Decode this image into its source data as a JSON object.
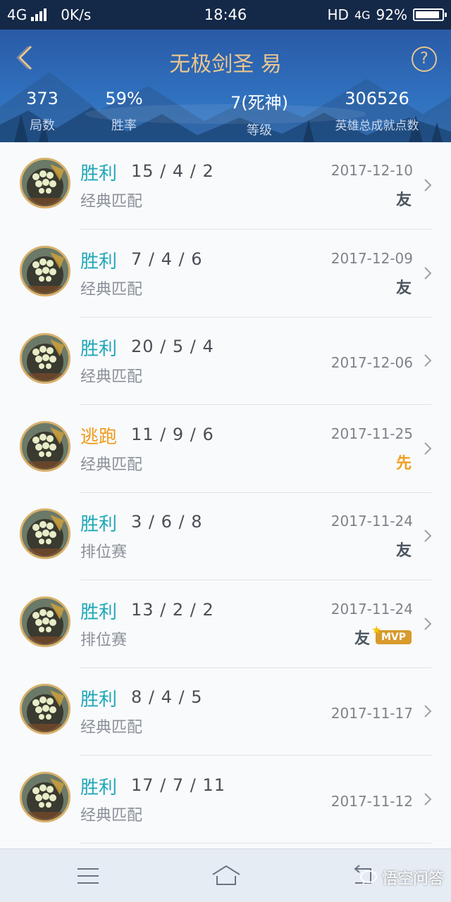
{
  "status_bar": {
    "network": "4G",
    "speed": "0K/s",
    "time": "18:46",
    "hd": "HD",
    "network_right": "4G",
    "battery": "92%",
    "battery_level": 0.92
  },
  "header": {
    "title": "无极剑圣 易",
    "stats": [
      {
        "value": "373",
        "label": "局数"
      },
      {
        "value": "59%",
        "label": "胜率"
      },
      {
        "value": "7(死神)",
        "label": "等级"
      },
      {
        "value": "306526",
        "label": "英雄总成就点数"
      }
    ]
  },
  "matches": [
    {
      "result": "胜利",
      "kda": "15 / 4 / 2",
      "mode": "经典匹配",
      "date": "2017-12-10",
      "tags": [
        "友"
      ]
    },
    {
      "result": "胜利",
      "kda": "7 / 4 / 6",
      "mode": "经典匹配",
      "date": "2017-12-09",
      "tags": [
        "友"
      ]
    },
    {
      "result": "胜利",
      "kda": "20 / 5 / 4",
      "mode": "经典匹配",
      "date": "2017-12-06",
      "tags": []
    },
    {
      "result": "逃跑",
      "kda": "11 / 9 / 6",
      "mode": "经典匹配",
      "date": "2017-11-25",
      "tags": [
        "先"
      ]
    },
    {
      "result": "胜利",
      "kda": "3 / 6 / 8",
      "mode": "排位赛",
      "date": "2017-11-24",
      "tags": [
        "友"
      ]
    },
    {
      "result": "胜利",
      "kda": "13 / 2 / 2",
      "mode": "排位赛",
      "date": "2017-11-24",
      "tags": [
        "友",
        "MVP"
      ]
    },
    {
      "result": "胜利",
      "kda": "8 / 4 / 5",
      "mode": "经典匹配",
      "date": "2017-11-17",
      "tags": []
    },
    {
      "result": "胜利",
      "kda": "17 / 7 / 11",
      "mode": "经典匹配",
      "date": "2017-11-12",
      "tags": []
    }
  ],
  "watermark": "悟空问答",
  "colors": {
    "win": "#1fa7b8",
    "flee": "#f09a1a",
    "title_gold": "#e9c690",
    "header_blue": "#2f6fbd"
  }
}
